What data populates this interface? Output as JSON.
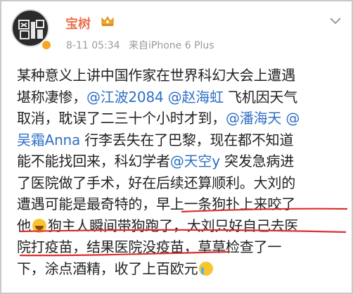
{
  "post": {
    "author": "宝树",
    "timestamp": "8-11 05:34",
    "source": "来自iPhone 6 Plus",
    "avatar_text": "区\n科 树",
    "lines": [
      [
        {
          "t": "某种意义上讲中国作家在世界科幻大会上遭遇"
        }
      ],
      [
        {
          "t": "堪称凄惨，"
        },
        {
          "m": "@江波2084"
        },
        {
          "t": " "
        },
        {
          "m": "@赵海虹"
        },
        {
          "t": " 飞机因天气"
        }
      ],
      [
        {
          "t": "取消，耽误了二三十个小时才到，"
        },
        {
          "m": "@潘海天"
        },
        {
          "t": " "
        },
        {
          "m": "@"
        }
      ],
      [
        {
          "m": "吴霜Anna"
        },
        {
          "t": " 行李丢失在了巴黎，现在都不知道"
        }
      ],
      [
        {
          "t": "能不能找回来，科幻学者"
        },
        {
          "m": "@天空y"
        },
        {
          "t": " 突发急病进"
        }
      ],
      [
        {
          "t": "了医院做了手术，好在后续还算顺利。大刘的"
        }
      ],
      [
        {
          "t": "遭遇可能是最奇特的，早上一条狗扑上来咬了"
        }
      ],
      [
        {
          "t": "他"
        },
        {
          "e": "laugh"
        },
        {
          "t": "狗主人瞬间带狗跑了，大刘只好自己去医"
        }
      ],
      [
        {
          "t": "院打疫苗，结果医院没疫苗，草草检查了一"
        }
      ],
      [
        {
          "t": "下，涂点酒精，收了上百欧元"
        },
        {
          "e": "cry"
        }
      ]
    ]
  },
  "colors": {
    "author": "#eb7350",
    "mention": "#2e6fc5",
    "underline": "#d9302c",
    "meta": "#9a9a9a"
  }
}
